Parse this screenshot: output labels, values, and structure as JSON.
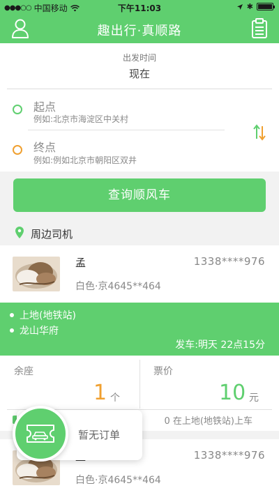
{
  "status_bar": {
    "carrier": "中国移动",
    "time": "下午11:03"
  },
  "navbar": {
    "title": "趣出行·真顺路",
    "left_icon": "user-icon",
    "right_icon": "clipboard-icon"
  },
  "departure": {
    "label": "出发时间",
    "value": "现在"
  },
  "route": {
    "start": {
      "label": "起点",
      "placeholder": "例如:北京市海淀区中关村",
      "color": "#5fcf6f"
    },
    "end": {
      "label": "终点",
      "placeholder": "例如:例如北京市朝阳区双井",
      "color": "#f0a030"
    },
    "swap_icon": "swap-icon"
  },
  "search_button": "查询顺风车",
  "nearby": {
    "label": "周边司机",
    "icon": "location-pin-icon"
  },
  "drivers": [
    {
      "name": "孟",
      "phone": "1338****976",
      "car": "白色·京4645**464",
      "stops": [
        "上地(地铁站)",
        "龙山华府"
      ],
      "departure": "发车:明天 22点15分",
      "seats_label": "余座",
      "seats_value": "1",
      "seats_unit": "个",
      "price_label": "票价",
      "price_value": "10",
      "price_unit": "元",
      "boarding": "0 在上地(地铁站)上车"
    },
    {
      "name": "孟",
      "phone": "1338****976",
      "car": "白色·京4645**464"
    }
  ],
  "floating": {
    "text": "暂无订单",
    "icon": "ticket-car-icon"
  },
  "colors": {
    "primary_green": "#5fcf6f",
    "accent_orange": "#f0a030"
  }
}
